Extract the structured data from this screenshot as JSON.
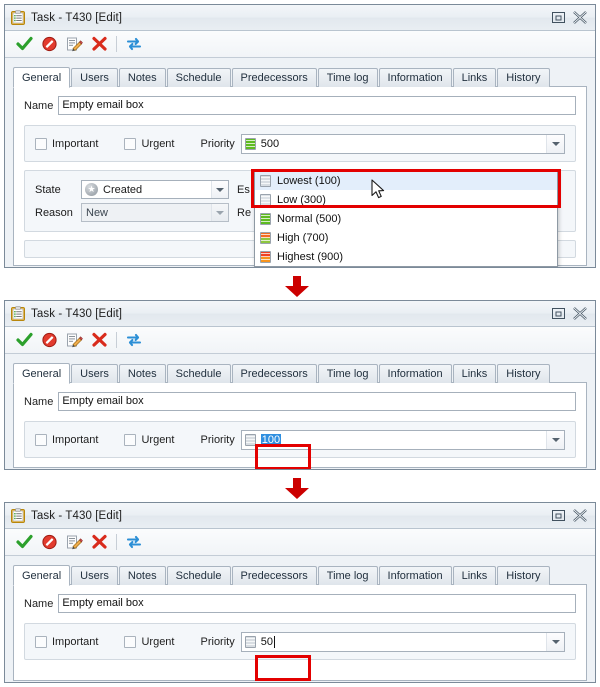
{
  "window": {
    "title": "Task - T430 [Edit]",
    "icon": "clipboard-icon",
    "restore_label": "▭",
    "close_label": "╳"
  },
  "toolbar": {
    "buttons": [
      {
        "name": "ok-accept-button",
        "icon": "green-check-icon",
        "label": "✔"
      },
      {
        "name": "cancel-button",
        "icon": "red-deny-icon",
        "label": "⃠"
      },
      {
        "name": "edit-button",
        "icon": "pencil-edit-icon",
        "label": "✎"
      },
      {
        "name": "delete-button",
        "icon": "red-x-icon",
        "label": "✖"
      },
      {
        "name": "refresh-button",
        "icon": "blue-refresh-icon",
        "label": "↻"
      }
    ]
  },
  "tabs": [
    {
      "label": "General",
      "active": true
    },
    {
      "label": "Users",
      "active": false
    },
    {
      "label": "Notes",
      "active": false
    },
    {
      "label": "Schedule",
      "active": false
    },
    {
      "label": "Predecessors",
      "active": false
    },
    {
      "label": "Time log",
      "active": false
    },
    {
      "label": "Information",
      "active": false
    },
    {
      "label": "Links",
      "active": false
    },
    {
      "label": "History",
      "active": false
    }
  ],
  "form": {
    "name_label": "Name",
    "name_value": "Empty email box",
    "important_label": "Important",
    "urgent_label": "Urgent",
    "priority_label": "Priority",
    "state_label": "State",
    "state_value": "Created",
    "reason_label": "Reason",
    "reason_value": "New",
    "estimated_label_stub": "Es",
    "remaining_label_stub": "Re"
  },
  "panels": {
    "panel1": {
      "priority_value": "500",
      "priority_icon_color": "#5fbb22"
    },
    "panel2": {
      "priority_value": "100",
      "priority_value_selected": true,
      "priority_icon_color": "#d8dde2"
    },
    "panel3": {
      "priority_value": "50",
      "priority_icon_color": "#d8dde2"
    }
  },
  "dropdown": {
    "items": [
      {
        "label": "Lowest (100)",
        "color": "#d8dde2",
        "hover": true
      },
      {
        "label": "Low (300)",
        "color": "#dde2e7",
        "hover": false
      },
      {
        "label": "Normal (500)",
        "color": "#5fbb22",
        "hover": false
      },
      {
        "label": "High (700)",
        "color": "#8dc63f",
        "hover": false
      },
      {
        "label": "Highest (900)",
        "color": "#f26c21",
        "hover": false
      }
    ]
  },
  "annotations": {
    "highlight_color": "#e30000",
    "arrow_color": "#cc0000",
    "arrow_glyph": "▼"
  }
}
